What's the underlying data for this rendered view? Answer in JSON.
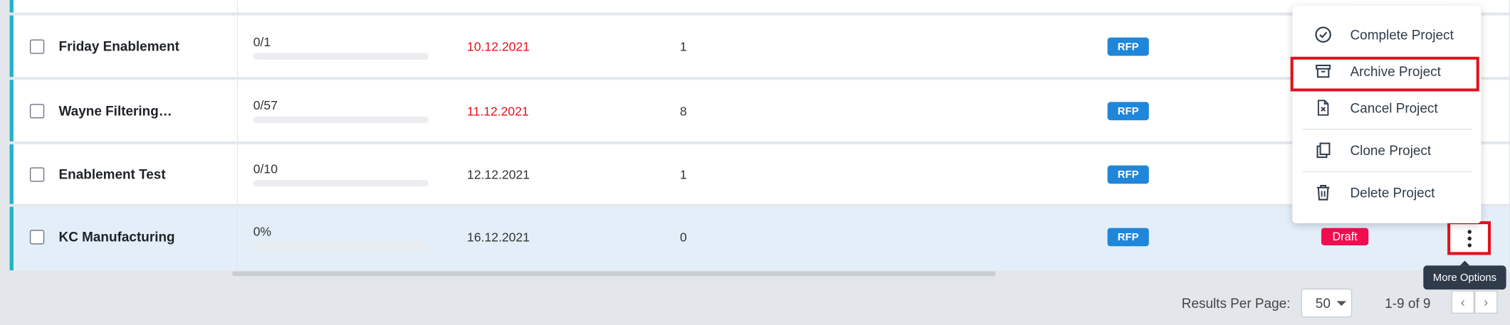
{
  "rows": [
    {
      "name": "Friday  Enablement",
      "progress_text": "0/1",
      "progress": 0,
      "date": "10.12.2021",
      "date_color": "#e0121d",
      "count": "1",
      "type": "RFP"
    },
    {
      "name": "Wayne Filtering…",
      "progress_text": "0/57",
      "progress": 0,
      "date": "11.12.2021",
      "date_color": "#e0121d",
      "count": "8",
      "type": "RFP"
    },
    {
      "name": "Enablement Test",
      "progress_text": "0/10",
      "progress": 0,
      "date": "12.12.2021",
      "date_color": "#333333",
      "count": "1",
      "type": "RFP"
    },
    {
      "name": "KC Manufacturing",
      "progress_text": "0%",
      "progress": 0,
      "date": "16.12.2021",
      "date_color": "#333333",
      "count": "0",
      "type": "RFP",
      "status": "Draft"
    }
  ],
  "menu": {
    "complete": "Complete Project",
    "archive": "Archive Project",
    "cancel": "Cancel Project",
    "clone": "Clone Project",
    "delete": "Delete Project"
  },
  "tooltip": "More Options",
  "footer": {
    "per_page_label": "Results Per Page:",
    "per_page_value": "50",
    "range": "1-9 of 9",
    "prev": "‹",
    "next": "›"
  },
  "colors": {
    "row_accent": "#25b3c5",
    "rfp_badge": "#1f86d9",
    "draft_badge": "#f20d4f",
    "highlight": "#e0121d"
  }
}
